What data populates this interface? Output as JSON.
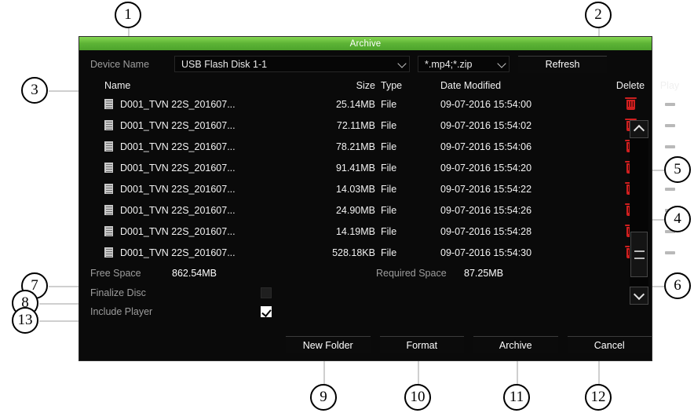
{
  "dialog": {
    "title": "Archive",
    "device_label": "Device Name",
    "device_value": "USB Flash Disk 1-1",
    "filter_value": "*.mp4;*.zip",
    "refresh_label": "Refresh"
  },
  "table": {
    "headers": {
      "name": "Name",
      "size": "Size",
      "type": "Type",
      "date": "Date Modified",
      "delete": "Delete",
      "play": "Play"
    },
    "rows": [
      {
        "name": "D001_TVN 22S_201607...",
        "size": "25.14MB",
        "type": "File",
        "date": "09-07-2016 15:54:00"
      },
      {
        "name": "D001_TVN 22S_201607...",
        "size": "72.11MB",
        "type": "File",
        "date": "09-07-2016 15:54:02"
      },
      {
        "name": "D001_TVN 22S_201607...",
        "size": "78.21MB",
        "type": "File",
        "date": "09-07-2016 15:54:06"
      },
      {
        "name": "D001_TVN 22S_201607...",
        "size": "91.41MB",
        "type": "File",
        "date": "09-07-2016 15:54:20"
      },
      {
        "name": "D001_TVN 22S_201607...",
        "size": "14.03MB",
        "type": "File",
        "date": "09-07-2016 15:54:22"
      },
      {
        "name": "D001_TVN 22S_201607...",
        "size": "24.90MB",
        "type": "File",
        "date": "09-07-2016 15:54:26"
      },
      {
        "name": "D001_TVN 22S_201607...",
        "size": "14.19MB",
        "type": "File",
        "date": "09-07-2016 15:54:28"
      },
      {
        "name": "D001_TVN 22S_201607...",
        "size": "528.18KB",
        "type": "File",
        "date": "09-07-2016 15:54:30"
      }
    ]
  },
  "status": {
    "free_space_label": "Free Space",
    "free_space_value": "862.54MB",
    "required_space_label": "Required Space",
    "required_space_value": "87.25MB"
  },
  "options": {
    "finalize_label": "Finalize Disc",
    "finalize_checked": false,
    "include_player_label": "Include Player",
    "include_player_checked": true
  },
  "buttons": {
    "new_folder": "New Folder",
    "format": "Format",
    "archive": "Archive",
    "cancel": "Cancel"
  },
  "callouts": [
    {
      "n": "1"
    },
    {
      "n": "2"
    },
    {
      "n": "3"
    },
    {
      "n": "4"
    },
    {
      "n": "5"
    },
    {
      "n": "6"
    },
    {
      "n": "7"
    },
    {
      "n": "8"
    },
    {
      "n": "9"
    },
    {
      "n": "10"
    },
    {
      "n": "11"
    },
    {
      "n": "12"
    },
    {
      "n": "13"
    }
  ],
  "colors": {
    "title_green": "#5cb335",
    "dialog_bg": "#0a0a0a",
    "delete_red": "#cf1f1f",
    "text": "#f2f2f2",
    "dim_text": "#9d9d9d"
  }
}
